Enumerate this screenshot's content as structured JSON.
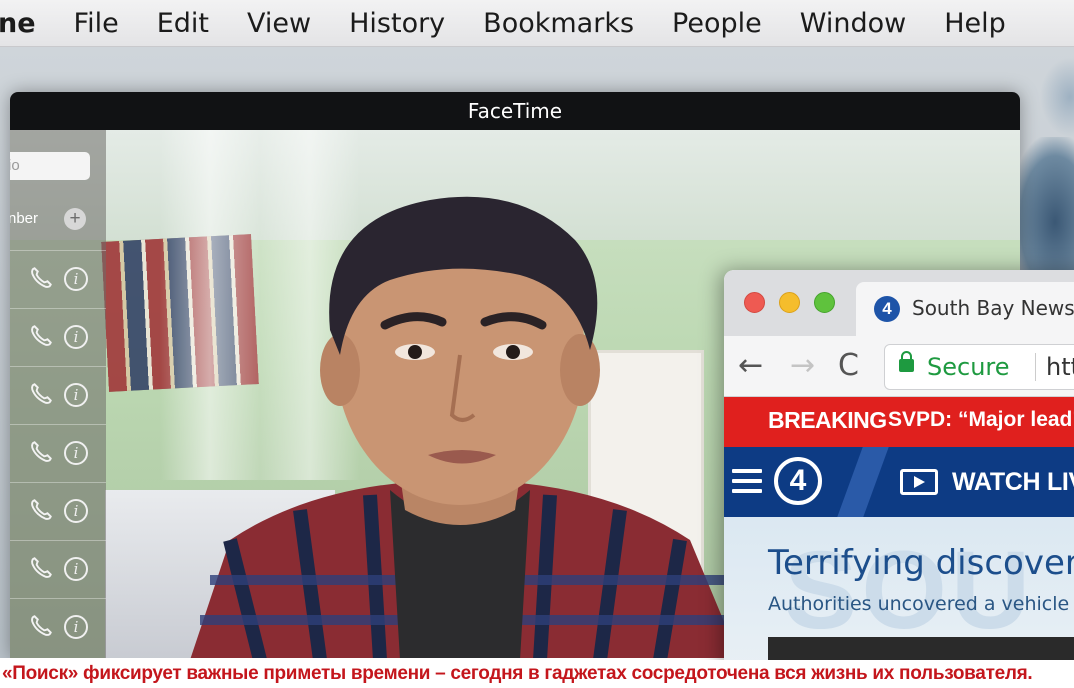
{
  "menubar": {
    "app_name": "ne",
    "items": [
      "File",
      "Edit",
      "View",
      "History",
      "Bookmarks",
      "People",
      "Window",
      "Help"
    ]
  },
  "facetime": {
    "title": "FaceTime",
    "sidebar": {
      "search_placeholder": "io",
      "number_label": "nber",
      "add_symbol": "+",
      "info_glyph": "i",
      "row_count": 7
    }
  },
  "browser": {
    "tab_title": "South Bay News |",
    "favicon_text": "4",
    "nav": {
      "back": "←",
      "forward": "→",
      "reload": "C"
    },
    "secure_label": "Secure",
    "url": "http",
    "breaking_label": "BREAKING",
    "breaking_text": "SVPD: “Major lead”",
    "logo_text": "4",
    "watch_label": "WATCH LIV",
    "watermark": "SOU",
    "headline": "Terrifying discovery i",
    "subhead": "Authorities uncovered a vehicle b"
  },
  "caption": "«Поиск» фиксирует важные приметы времени – сегодня в гаджетах сосредоточена вся жизнь их пользователя.",
  "colors": {
    "breaking_red": "#e0201e",
    "news_blue": "#0d3b84",
    "caption_red": "#c4161c",
    "secure_green": "#1e9a40"
  },
  "icons": [
    "phone-icon",
    "info-icon",
    "add-icon",
    "lock-icon",
    "play-icon",
    "hamburger-icon"
  ]
}
